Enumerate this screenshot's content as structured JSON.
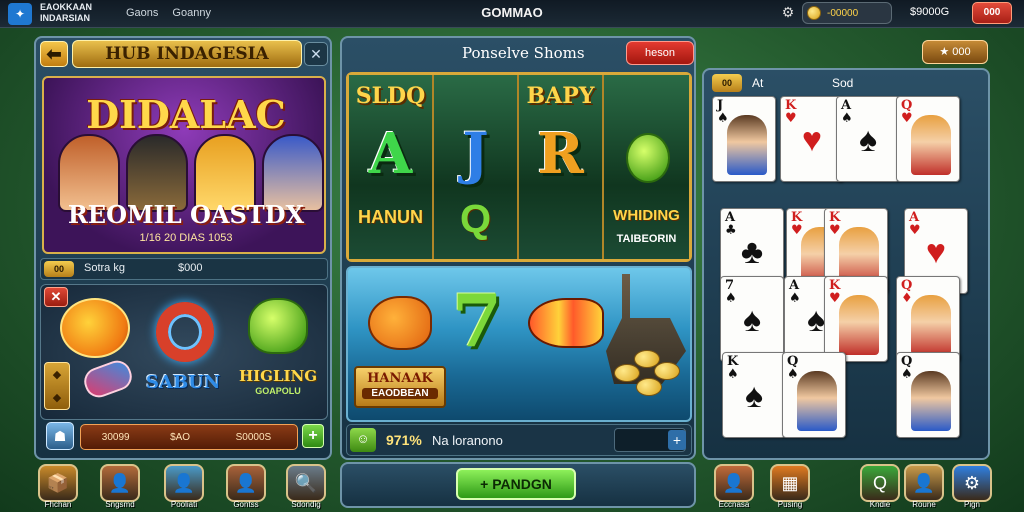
{
  "topbar": {
    "brand": "EAOKKAAN INDARSIAN",
    "nav": [
      "Gaons",
      "Goanny"
    ],
    "title": "GOMMAO",
    "coins": "-00000",
    "balance": "$9000G",
    "action": "000"
  },
  "left_panel": {
    "title": "HUB INDAGESIA",
    "banner": {
      "title": "DIDALAC",
      "subtitle": "REOMIL OASTDX",
      "date": "1/16 20 DIAS 1053"
    },
    "info_row": {
      "badge": "00",
      "label": "Sotra kg",
      "value": "$000"
    },
    "symbols": {
      "label_1": "SABUN",
      "label_2": "HIGLING",
      "label_3": "GOAPOLU"
    },
    "bet_row": [
      "30099",
      "$AO",
      "S0000S"
    ]
  },
  "middle_panel": {
    "header_label": "Ponselve Shoms",
    "header_button": "heson",
    "reels": [
      {
        "top": "SLDQ",
        "big": "A",
        "big_color": "#3fd64a",
        "bottom": "HANUN",
        "bottom2": ""
      },
      {
        "top": "",
        "big": "J",
        "big_color": "#2e7ee6",
        "bottom": "Q",
        "bottom2": ""
      },
      {
        "top": "BAPY",
        "big": "R",
        "big_color": "#f0a020",
        "bottom": "",
        "bottom2": ""
      },
      {
        "top": "",
        "big": "",
        "big_color": "#7ad83a",
        "bottom": "WHIDING",
        "bottom2": "TAIBEORIN"
      }
    ],
    "scene": {
      "seven": "7",
      "label_1": "HANAAK",
      "label_2": "EAODBEAN"
    },
    "stat": {
      "value": "971%",
      "label": "Na loranono"
    },
    "cta": "PANDGN"
  },
  "right_panel": {
    "top_button": "000",
    "badge": "00",
    "label_1": "At",
    "label_2": "Sod",
    "cards": [
      {
        "rank": "J",
        "suit": "♠",
        "color": "blk",
        "face": true
      },
      {
        "rank": "K",
        "suit": "♥",
        "color": "red",
        "face": false
      },
      {
        "rank": "A",
        "suit": "♠",
        "color": "blk",
        "face": false
      },
      {
        "rank": "Q",
        "suit": "♥",
        "color": "red",
        "face": true
      },
      {
        "rank": "A",
        "suit": "♣",
        "color": "blk",
        "face": false
      },
      {
        "rank": "K",
        "suit": "♥",
        "color": "red",
        "face": true
      },
      {
        "rank": "K",
        "suit": "♥",
        "color": "red",
        "face": true
      },
      {
        "rank": "A",
        "suit": "♥",
        "color": "red",
        "face": false
      },
      {
        "rank": "7",
        "suit": "♠",
        "color": "blk",
        "face": false
      },
      {
        "rank": "A",
        "suit": "♠",
        "color": "blk",
        "face": false
      },
      {
        "rank": "K",
        "suit": "♥",
        "color": "red",
        "face": true
      },
      {
        "rank": "Q",
        "suit": "♦",
        "color": "red",
        "face": true
      },
      {
        "rank": "K",
        "suit": "♠",
        "color": "blk",
        "face": false
      },
      {
        "rank": "Q",
        "suit": "♠",
        "color": "blk",
        "face": true
      },
      {
        "rank": "Q",
        "suit": "♠",
        "color": "blk",
        "face": true
      }
    ]
  },
  "dock": {
    "left": [
      {
        "label": "Fhchan",
        "icon": "📦"
      },
      {
        "label": "Sngsmd",
        "icon": "👤"
      },
      {
        "label": "Pooliati",
        "icon": "👤"
      },
      {
        "label": "Gontss",
        "icon": "👤"
      },
      {
        "label": "Sdondig",
        "icon": "🔍"
      }
    ],
    "right": [
      {
        "label": "Eccnasa",
        "icon": "👤"
      },
      {
        "label": "Pusing",
        "icon": "▦"
      },
      {
        "label": "Kndie",
        "icon": "Q"
      },
      {
        "label": "Roune",
        "icon": "👤"
      },
      {
        "label": "Pign",
        "icon": "⚙"
      }
    ]
  },
  "colors": {
    "gold": "#d9a93a",
    "panel": "#2b4f66",
    "cta_green": "#2e9a16",
    "danger_red": "#d8402a"
  }
}
